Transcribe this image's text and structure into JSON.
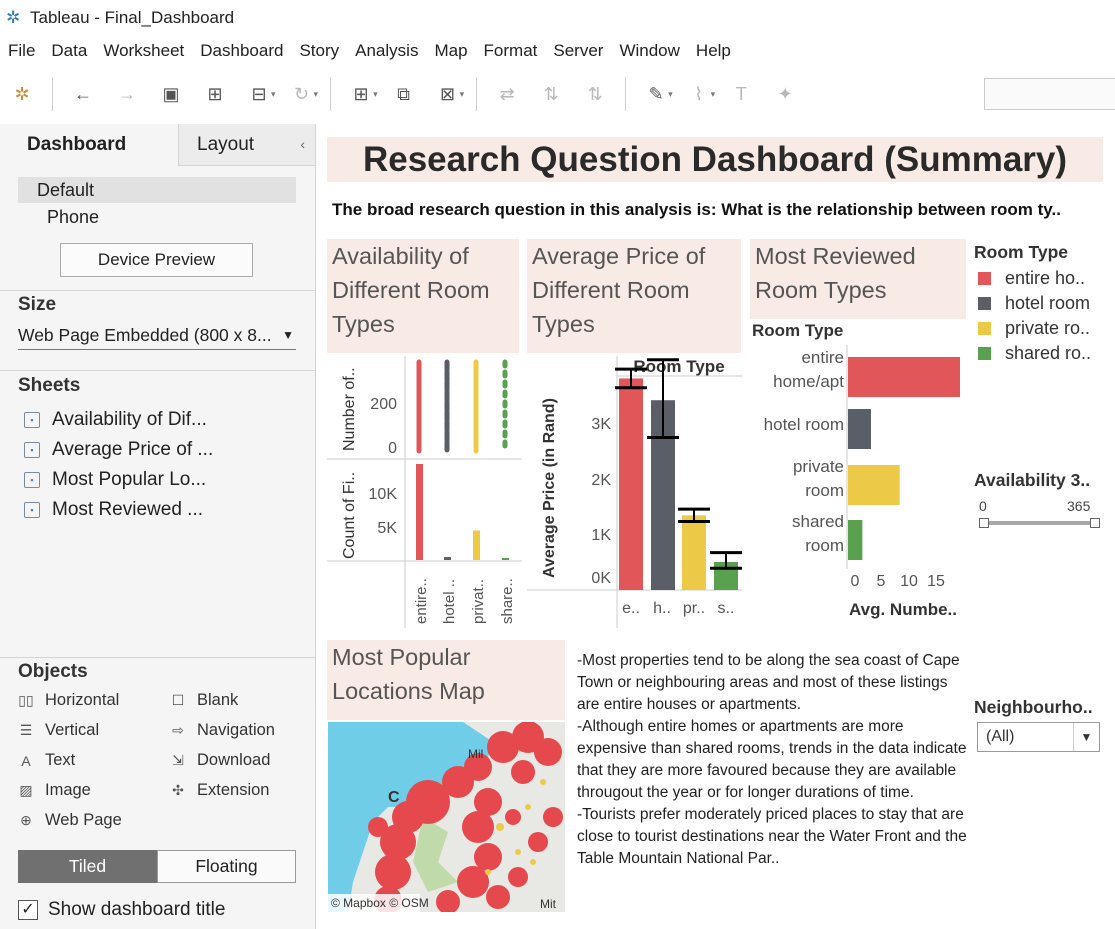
{
  "window": {
    "title": "Tableau - Final_Dashboard"
  },
  "menu": [
    "File",
    "Data",
    "Worksheet",
    "Dashboard",
    "Story",
    "Analysis",
    "Map",
    "Format",
    "Server",
    "Window",
    "Help"
  ],
  "left_panel": {
    "tabs": {
      "dashboard": "Dashboard",
      "layout": "Layout"
    },
    "devices": {
      "default": "Default",
      "phone": "Phone"
    },
    "device_preview": "Device Preview",
    "size": {
      "heading": "Size",
      "value": "Web Page Embedded (800 x 8..."
    },
    "sheets": {
      "heading": "Sheets",
      "items": [
        "Availability of Dif...",
        "Average Price of ...",
        "Most Popular Lo...",
        "Most Reviewed ..."
      ]
    },
    "objects": {
      "heading": "Objects",
      "items": [
        "Horizontal",
        "Blank",
        "Vertical",
        "Navigation",
        "Text",
        "Download",
        "Image",
        "Extension",
        "Web Page"
      ]
    },
    "tiled": "Tiled",
    "floating": "Floating",
    "show_title": "Show dashboard title"
  },
  "dashboard": {
    "title": "Research Question Dashboard (Summary)",
    "question": "The broad research question in this analysis is: What is the relationship between room ty..",
    "panel1_title": [
      "Availability of",
      "Different Room",
      "Types"
    ],
    "panel2_title": [
      "Average Price of",
      "Different Room",
      "Types"
    ],
    "panel3_title": [
      "Most Reviewed",
      "Room Types"
    ],
    "panel4_title": [
      "Most Popular",
      "Locations Map"
    ],
    "notes": [
      "-Most properties tend to be along the sea coast of Cape Town or neighbouring areas and most of these listings are entire houses or apartments.",
      "-Although entire homes or apartments are more expensive than shared rooms, trends in the data indicate that they are more favoured because they are available througout the year or for longer durations of time.",
      "-Tourists prefer moderately priced places to stay that are close to tourist destinations near the Water Front and the Table Mountain National Par.."
    ],
    "map_labels": {
      "attribution": "© Mapbox © OSM",
      "mil": "Mil",
      "c": "C",
      "mit": "Mit"
    }
  },
  "legend": {
    "title": "Room Type",
    "items": [
      {
        "label": "entire ho..",
        "color": "#e15759"
      },
      {
        "label": "hotel room",
        "color": "#5a5e66"
      },
      {
        "label": "private ro..",
        "color": "#edc948"
      },
      {
        "label": "shared ro..",
        "color": "#59a14f"
      }
    ]
  },
  "filters": {
    "availability": {
      "title": "Availability 3..",
      "min": "0",
      "max": "365"
    },
    "neighbourhood": {
      "title": "Neighbourho..",
      "value": "(All)"
    }
  },
  "chart_data": [
    {
      "type": "bar",
      "title": "Availability of Different Room Types",
      "ylabel_top": "Number of..",
      "ylabel_bottom": "Count of Fi..",
      "categories": [
        "entire..",
        "hotel ..",
        "privat..",
        "share.."
      ],
      "top_ticks": [
        "200",
        "0"
      ],
      "bottom_ticks": [
        "10K",
        "5K"
      ],
      "bottom_values": [
        13000,
        400,
        4000,
        200
      ],
      "bottom_ylim": [
        0,
        13000
      ]
    },
    {
      "type": "bar",
      "title": "Average Price of Different Room Types",
      "header": "Room Type",
      "ylabel": "Average Price (in Rand)",
      "categories": [
        "e..",
        "h..",
        "pr..",
        "s.."
      ],
      "ticks": [
        "3K",
        "2K",
        "1K",
        "0K"
      ],
      "values": [
        3400,
        3050,
        1200,
        450
      ],
      "error_low": [
        3250,
        2450,
        1100,
        350
      ],
      "error_high": [
        3550,
        3700,
        1300,
        600
      ],
      "ylim": [
        0,
        3600
      ]
    },
    {
      "type": "bar",
      "orientation": "horizontal",
      "title": "Most Reviewed Room Types",
      "header": "Room Type",
      "xlabel": "Avg. Numbe..",
      "categories": [
        [
          "entire",
          "home/apt"
        ],
        [
          "hotel room"
        ],
        [
          "private",
          "room"
        ],
        [
          "shared",
          "room"
        ]
      ],
      "values": [
        19.5,
        4,
        9,
        2.5
      ],
      "ticks": [
        "0",
        "5",
        "10",
        "15"
      ],
      "xlim": [
        0,
        19.5
      ]
    }
  ]
}
